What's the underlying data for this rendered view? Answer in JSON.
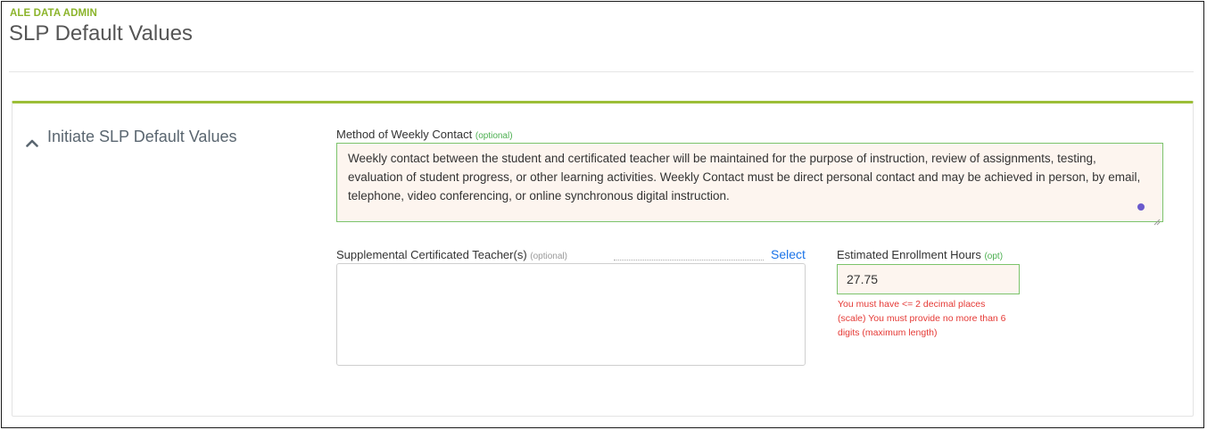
{
  "header": {
    "eyebrow": "ALE DATA ADMIN",
    "title": "SLP Default Values"
  },
  "section": {
    "heading": "Initiate SLP Default Values",
    "icon": "chevron-up-icon"
  },
  "method_of_weekly_contact": {
    "label": "Method of Weekly Contact",
    "qualifier": "(optional)",
    "value": "Weekly contact between the student and certificated teacher will be maintained for the purpose of instruction, review of assignments, testing, evaluation of student progress, or other learning activities. Weekly Contact must be direct personal contact and may be achieved in person, by email, telephone, video conferencing, or online synchronous digital instruction."
  },
  "supplemental_teachers": {
    "label": "Supplemental Certificated Teacher(s)",
    "qualifier": "(optional)",
    "select_label": "Select",
    "value": ""
  },
  "estimated_enrollment_hours": {
    "label": "Estimated Enrollment Hours",
    "qualifier": "(opt)",
    "value": "27.75",
    "error": "You must have <= 2 decimal places (scale) You must provide no more than 6 digits (maximum length)"
  },
  "colors": {
    "accent_green": "#9cbe37",
    "eyebrow_green": "#8bb42a",
    "valid_border": "#7cc36b",
    "error_red": "#e53935",
    "link_blue": "#1a73e8"
  }
}
